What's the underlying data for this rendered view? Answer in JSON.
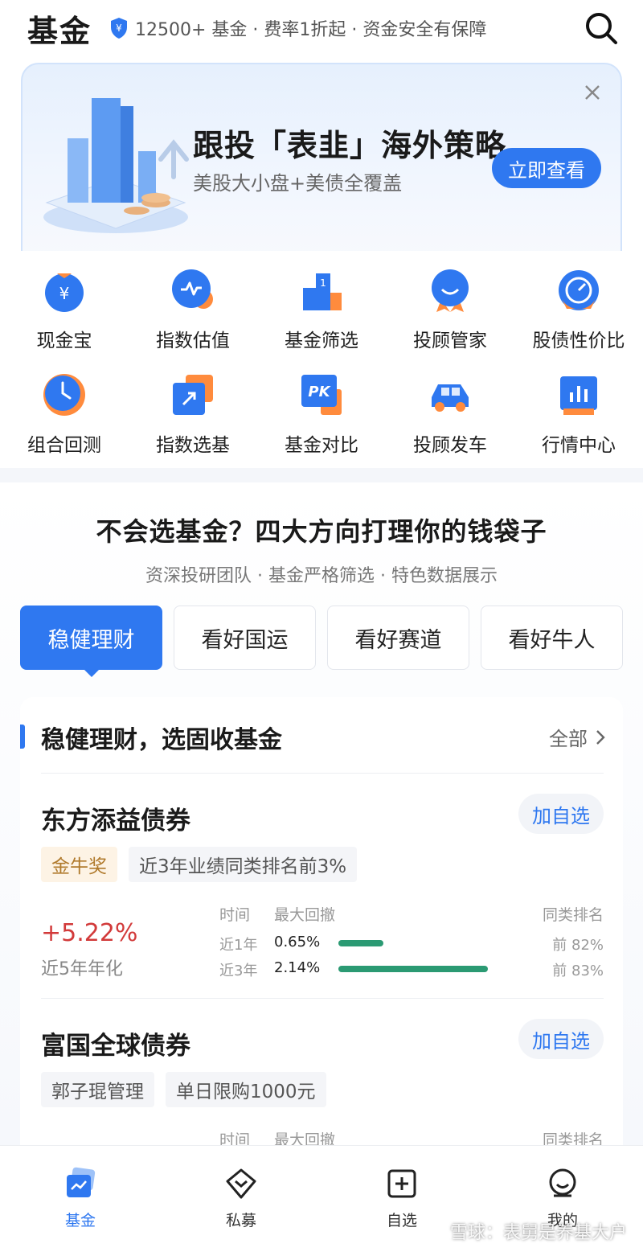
{
  "header": {
    "title": "基金",
    "tagline": "12500+ 基金 · 费率1折起 · 资金安全有保障"
  },
  "banner": {
    "headline": "跟投「表韭」海外策略",
    "subline": "美股大小盘+美债全覆盖",
    "cta": "立即查看"
  },
  "quick_grid": [
    {
      "label": "现金宝",
      "icon": "yuan-pouch-icon"
    },
    {
      "label": "指数估值",
      "icon": "pulse-icon"
    },
    {
      "label": "基金筛选",
      "icon": "podium-icon"
    },
    {
      "label": "投顾管家",
      "icon": "smile-medal-icon"
    },
    {
      "label": "股债性价比",
      "icon": "gauge-icon"
    },
    {
      "label": "组合回测",
      "icon": "clock-icon"
    },
    {
      "label": "指数选基",
      "icon": "arrow-square-icon"
    },
    {
      "label": "基金对比",
      "icon": "pk-icon"
    },
    {
      "label": "投顾发车",
      "icon": "car-icon"
    },
    {
      "label": "行情中心",
      "icon": "bar-chart-icon"
    }
  ],
  "section": {
    "title": "不会选基金？四大方向打理你的钱袋子",
    "subtitle": "资深投研团队 · 基金严格筛选 · 特色数据展示",
    "tabs": [
      "稳健理财",
      "看好国运",
      "看好赛道",
      "看好牛人"
    ],
    "active_tab": 0
  },
  "card": {
    "title": "稳健理财，选固收基金",
    "all_label": "全部",
    "funds": [
      {
        "name": "东方添益债券",
        "add_label": "加自选",
        "tags": [
          "金牛奖",
          "近3年业绩同类排名前3%"
        ],
        "return": "+5.22%",
        "return_label": "近5年年化",
        "col_time": "时间",
        "col_drawdown": "最大回撤",
        "col_rank": "同类排名",
        "rows": [
          {
            "period": "近1年",
            "drawdown": "0.65%",
            "drawdown_fraction": 0.3,
            "rank": "前 82%"
          },
          {
            "period": "近3年",
            "drawdown": "2.14%",
            "drawdown_fraction": 1.0,
            "rank": "前 83%"
          }
        ]
      },
      {
        "name": "富国全球债券",
        "add_label": "加自选",
        "tags": [
          "郭子琨管理",
          "单日限购1000元"
        ],
        "col_time": "时间",
        "col_drawdown": "最大回撤",
        "col_rank": "同类排名"
      }
    ]
  },
  "nav": {
    "items": [
      "基金",
      "私募",
      "自选",
      "我的"
    ],
    "active": 0,
    "watermark": "雪球：表舅是养基大户"
  },
  "colors": {
    "accent": "#2f78f0",
    "positive": "#d23a3a",
    "bar": "#2b9a73",
    "gold_tag": "#b07a2c"
  }
}
